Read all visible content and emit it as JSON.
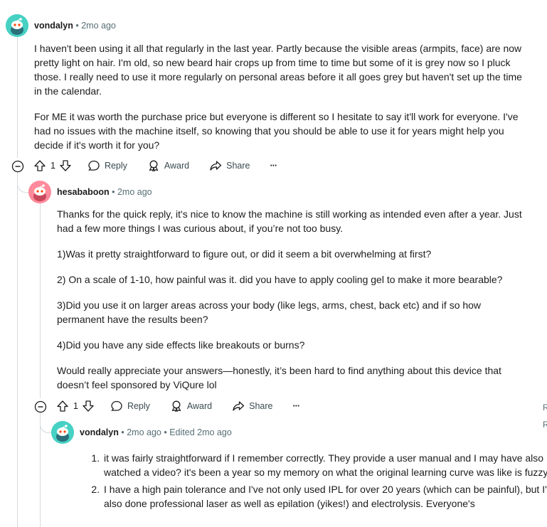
{
  "comment1": {
    "username": "vondalyn",
    "time": "2mo ago",
    "paragraphs": [
      "I haven't been using it all that regularly in the last year. Partly because the visible areas (armpits, face) are now pretty light on hair. I'm old, so new beard hair crops up from time to time but some of it is grey now so I pluck those. I really need to use it more regularly on personal areas before it all goes grey but haven't set up the time in the calendar.",
      "For ME it was worth the purchase price but everyone is different so I hesitate to say it'll work for everyone. I've had no issues with the machine itself, so knowing that you should be able to use it for years might help you decide if it's worth it for you?"
    ],
    "votes": "1",
    "reply_label": "Reply",
    "award_label": "Award",
    "share_label": "Share",
    "more_label": "···"
  },
  "comment2": {
    "username": "hesababoon",
    "time": "2mo ago",
    "paragraphs": [
      "Thanks for the quick reply, it's nice to know the machine is still working as intended even after a year. Just had a few more things I was curious about, if you’re not too busy.",
      "1)Was it pretty straightforward to figure out, or did it seem a bit overwhelming at first?",
      "2) On a scale of 1-10, how painful was it. did you have to apply cooling gel to make it more bearable?",
      "3)Did you use it on larger areas across your body (like legs, arms, chest, back etc) and if so how permanent have the results been?",
      "4)Did you have any side effects like breakouts or burns?",
      "Would really appreciate your answers—honestly, it’s been hard to find anything about this device that doesn’t feel sponsored by ViQure lol"
    ],
    "votes": "1",
    "reply_label": "Reply",
    "award_label": "Award",
    "share_label": "Share",
    "more_label": "···"
  },
  "comment3": {
    "username": "vondalyn",
    "time": "2mo ago",
    "edited": "Edited 2mo ago",
    "items": [
      "it was fairly straightforward if I remember correctly. They provide a user manual and I may have also watched a video? it's been a year so my memory on what the original learning curve was like is fuzzy.",
      "I have a high pain tolerance and I've not only used IPL for over 20 years (which can be painful), but I've also done professional laser as well as epilation (yikes!) and electrolysis. Everyone's"
    ]
  },
  "right_edge": [
    "R",
    "R"
  ],
  "colors": {
    "avatar_teal": "#46d1c3",
    "avatar_pink": "#ff8a9b",
    "meta_gray": "#576f76",
    "line_gray": "#d5dadd"
  },
  "icons": [
    "snoo-avatar-icon",
    "collapse-icon",
    "upvote-icon",
    "downvote-icon",
    "reply-bubble-icon",
    "award-icon",
    "share-icon",
    "more-icon"
  ]
}
